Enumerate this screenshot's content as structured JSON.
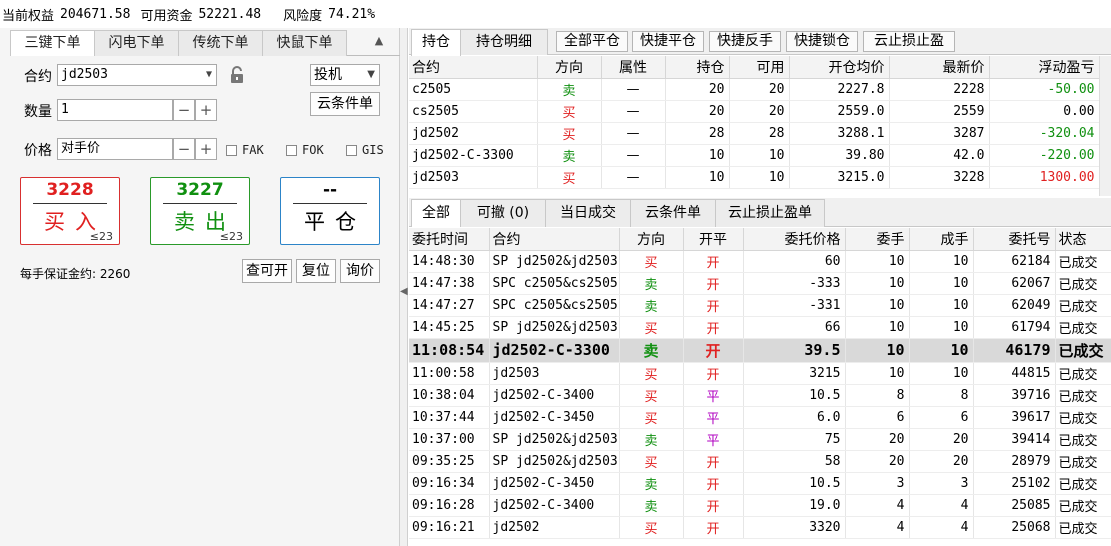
{
  "topbar": {
    "equity_label": "当前权益",
    "equity_value": "204671.58",
    "available_label": "可用资金",
    "available_value": "52221.48",
    "risk_label": "风险度",
    "risk_value": "74.21%"
  },
  "order_panel": {
    "tabs": [
      "三键下单",
      "闪电下单",
      "传统下单",
      "快鼠下单"
    ],
    "contract_label": "合约",
    "contract_value": "jd2503",
    "hedge_value": "投机",
    "cloud_btn": "云条件单",
    "qty_label": "数量",
    "qty_value": "1",
    "price_label": "价格",
    "price_value": "对手价",
    "opts": [
      "FAK",
      "FOK",
      "GIS"
    ],
    "buy": {
      "price": "3228",
      "label": "买入",
      "qty": "≤23"
    },
    "sell": {
      "price": "3227",
      "label": "卖出",
      "qty": "≤23"
    },
    "close": {
      "price": "--",
      "label": "平仓"
    },
    "margin_text": "每手保证金约: 2260",
    "btn_query": "查可开",
    "btn_reset": "复位",
    "btn_inquiry": "询价"
  },
  "positions": {
    "tabs": [
      "持仓",
      "持仓明细"
    ],
    "actions": [
      "全部平仓",
      "快捷平仓",
      "快捷反手",
      "快捷锁仓",
      "云止损止盈"
    ],
    "headers": [
      "合约",
      "方向",
      "属性",
      "持仓",
      "可用",
      "开仓均价",
      "最新价",
      "浮动盈亏"
    ],
    "rows": [
      {
        "contract": "c2505",
        "dir": "卖",
        "attr": "—",
        "pos": "20",
        "avail": "20",
        "open": "2227.8",
        "last": "2228",
        "pnl": "-50.00",
        "dircls": "green",
        "pnlcls": "neg"
      },
      {
        "contract": "cs2505",
        "dir": "买",
        "attr": "—",
        "pos": "20",
        "avail": "20",
        "open": "2559.0",
        "last": "2559",
        "pnl": "0.00",
        "dircls": "red",
        "pnlcls": ""
      },
      {
        "contract": "jd2502",
        "dir": "买",
        "attr": "—",
        "pos": "28",
        "avail": "28",
        "open": "3288.1",
        "last": "3287",
        "pnl": "-320.04",
        "dircls": "red",
        "pnlcls": "neg"
      },
      {
        "contract": "jd2502-C-3300",
        "dir": "卖",
        "attr": "—",
        "pos": "10",
        "avail": "10",
        "open": "39.80",
        "last": "42.0",
        "pnl": "-220.00",
        "dircls": "green",
        "pnlcls": "neg"
      },
      {
        "contract": "jd2503",
        "dir": "买",
        "attr": "—",
        "pos": "10",
        "avail": "10",
        "open": "3215.0",
        "last": "3228",
        "pnl": "1300.00",
        "dircls": "red",
        "pnlcls": "pos"
      }
    ]
  },
  "orders": {
    "tabs": [
      "全部",
      "可撤 (0)",
      "当日成交",
      "云条件单",
      "云止损止盈单"
    ],
    "headers": [
      "委托时间",
      "合约",
      "方向",
      "开平",
      "委托价格",
      "委手",
      "成手",
      "委托号",
      "状态"
    ],
    "rows": [
      {
        "time": "14:48:30",
        "contract": "SP jd2502&jd2503",
        "dir": "买",
        "oc": "开",
        "price": "60",
        "ord": "10",
        "fill": "10",
        "id": "62184",
        "status": "已成交",
        "dircls": "red",
        "occls": "red"
      },
      {
        "time": "14:47:38",
        "contract": "SPC c2505&cs2505",
        "dir": "卖",
        "oc": "开",
        "price": "-333",
        "ord": "10",
        "fill": "10",
        "id": "62067",
        "status": "已成交",
        "dircls": "green",
        "occls": "red"
      },
      {
        "time": "14:47:27",
        "contract": "SPC c2505&cs2505",
        "dir": "卖",
        "oc": "开",
        "price": "-331",
        "ord": "10",
        "fill": "10",
        "id": "62049",
        "status": "已成交",
        "dircls": "green",
        "occls": "red"
      },
      {
        "time": "14:45:25",
        "contract": "SP jd2502&jd2503",
        "dir": "买",
        "oc": "开",
        "price": "66",
        "ord": "10",
        "fill": "10",
        "id": "61794",
        "status": "已成交",
        "dircls": "red",
        "occls": "red"
      },
      {
        "time": "11:08:54",
        "contract": "jd2502-C-3300",
        "dir": "卖",
        "oc": "开",
        "price": "39.5",
        "ord": "10",
        "fill": "10",
        "id": "46179",
        "status": "已成交",
        "dircls": "green",
        "occls": "red",
        "highlight": true
      },
      {
        "time": "11:00:58",
        "contract": "jd2503",
        "dir": "买",
        "oc": "开",
        "price": "3215",
        "ord": "10",
        "fill": "10",
        "id": "44815",
        "status": "已成交",
        "dircls": "red",
        "occls": "red"
      },
      {
        "time": "10:38:04",
        "contract": "jd2502-C-3400",
        "dir": "买",
        "oc": "平",
        "price": "10.5",
        "ord": "8",
        "fill": "8",
        "id": "39716",
        "status": "已成交",
        "dircls": "red",
        "occls": "purple"
      },
      {
        "time": "10:37:44",
        "contract": "jd2502-C-3450",
        "dir": "买",
        "oc": "平",
        "price": "6.0",
        "ord": "6",
        "fill": "6",
        "id": "39617",
        "status": "已成交",
        "dircls": "red",
        "occls": "purple"
      },
      {
        "time": "10:37:00",
        "contract": "SP jd2502&jd2503",
        "dir": "卖",
        "oc": "平",
        "price": "75",
        "ord": "20",
        "fill": "20",
        "id": "39414",
        "status": "已成交",
        "dircls": "green",
        "occls": "purple"
      },
      {
        "time": "09:35:25",
        "contract": "SP jd2502&jd2503",
        "dir": "买",
        "oc": "开",
        "price": "58",
        "ord": "20",
        "fill": "20",
        "id": "28979",
        "status": "已成交",
        "dircls": "red",
        "occls": "red"
      },
      {
        "time": "09:16:34",
        "contract": "jd2502-C-3450",
        "dir": "卖",
        "oc": "开",
        "price": "10.5",
        "ord": "3",
        "fill": "3",
        "id": "25102",
        "status": "已成交",
        "dircls": "green",
        "occls": "red"
      },
      {
        "time": "09:16:28",
        "contract": "jd2502-C-3400",
        "dir": "卖",
        "oc": "开",
        "price": "19.0",
        "ord": "4",
        "fill": "4",
        "id": "25085",
        "status": "已成交",
        "dircls": "green",
        "occls": "red"
      },
      {
        "time": "09:16:21",
        "contract": "jd2502",
        "dir": "买",
        "oc": "开",
        "price": "3320",
        "ord": "4",
        "fill": "4",
        "id": "25068",
        "status": "已成交",
        "dircls": "red",
        "occls": "red"
      }
    ]
  }
}
